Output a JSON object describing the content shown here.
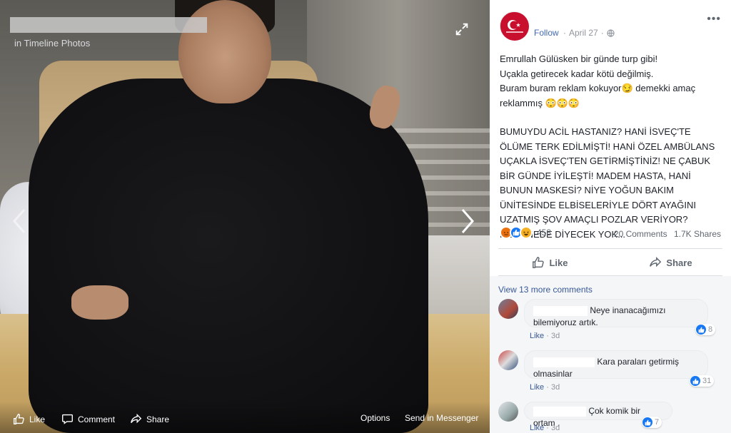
{
  "viewer": {
    "album_label": "in Timeline Photos",
    "bottom_actions": {
      "like": "Like",
      "comment": "Comment",
      "share": "Share",
      "options": "Options",
      "send": "Send in Messenger"
    }
  },
  "post": {
    "follow": "Follow",
    "separator": "·",
    "date": "April 27",
    "separator2": "·",
    "paragraph1": "Emrullah Gülüsken bir günde turp gibi!\nUçakla getirecek kadar kötü değilmiş.\nBuram buram reklam kokuyor😏 demekki amaç reklammış 😳😳😳",
    "paragraph2": "BUMUYDU ACİL HASTANIZ? HANİ İSVEÇ'TE ÖLÜME TERK EDİLMİŞTİ! HANİ ÖZEL AMBÜLANS UÇAKLA İSVEÇ'TEN GETİRMİŞTİNİZ! NE ÇABUK BİR GÜNDE İYİLEŞTİ! MADEM HASTA, HANİ BUNUN MASKESİ? NİYE YOĞUN BAKIM ÜNİTESİNDE ELBİSELERİYLE DÖRT AYAĞINI UZATMIŞ ŞOV AMAÇLI POZLAR VERİYOR? KEYFİNEDE DİYECEK YOK...",
    "reaction_count": "458",
    "comments_count": "20 Comments",
    "shares_count": "1.7K Shares",
    "like_label": "Like",
    "share_label": "Share"
  },
  "comments": {
    "view_more": "View 13 more comments",
    "items": [
      {
        "text": "Neye inanacağımızı bilemiyoruz artık.",
        "like": "Like",
        "dot": "·",
        "time": "3d",
        "reactions": "8"
      },
      {
        "text": "Kara paraları getirmiş olmasinlar",
        "like": "Like",
        "dot": "·",
        "time": "3d",
        "reactions": "31"
      },
      {
        "text": "Çok komik bir ortam ,",
        "like": "Like",
        "dot": "·",
        "time": "3d",
        "reactions": "7"
      }
    ]
  },
  "colors": {
    "link": "#4267b2",
    "page_avatar": "#c8102e",
    "like_blue": "#1877f2"
  }
}
